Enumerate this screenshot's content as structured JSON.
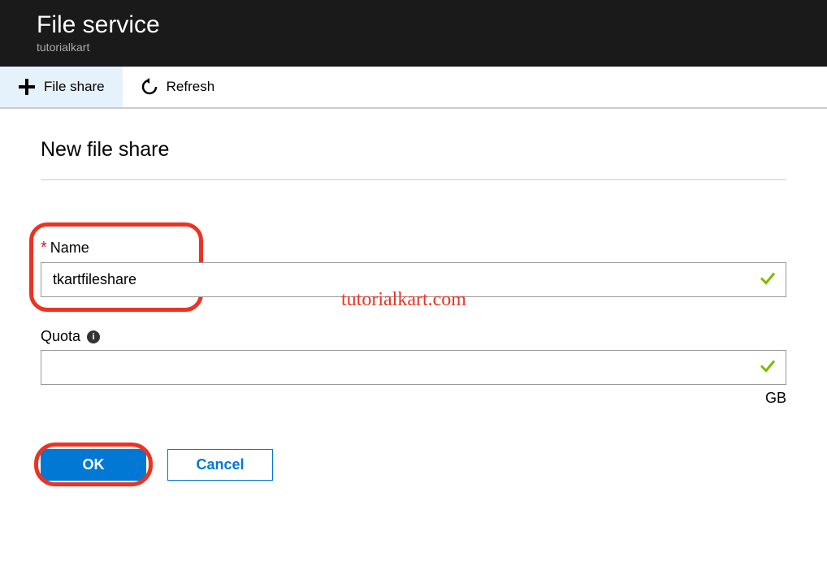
{
  "header": {
    "title": "File service",
    "subtitle": "tutorialkart"
  },
  "toolbar": {
    "file_share": "File share",
    "refresh": "Refresh"
  },
  "panel": {
    "title": "New file share",
    "name_label": "Name",
    "name_value": "tkartfileshare",
    "quota_label": "Quota",
    "quota_value": "",
    "quota_unit": "GB",
    "ok_label": "OK",
    "cancel_label": "Cancel"
  },
  "watermark": "tutorialkart.com"
}
